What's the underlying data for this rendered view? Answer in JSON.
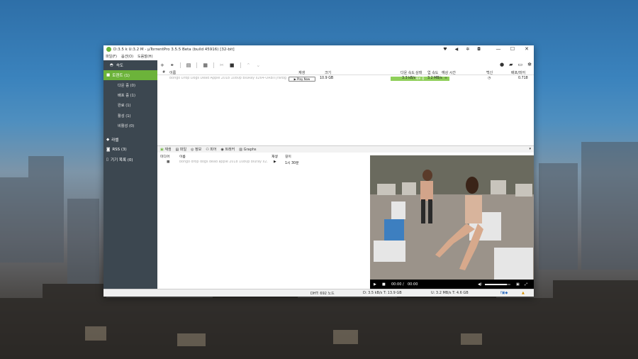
{
  "titlebar": {
    "title": "D:3.5 k U:3.2 M - µTorrentPro 3.5.5 Beta (build 45916) [32-bit]"
  },
  "menu": [
    "파일(F)",
    "옵션(O)",
    "도움말(H)"
  ],
  "sidebar": {
    "speed": "속도",
    "torrents": "토렌트 (1)",
    "subs": [
      "다운 중 (0)",
      "배포 중 (1)",
      "완료 (1)",
      "활성 (1)",
      "비활성 (0)"
    ],
    "labels": "라벨",
    "rss": "RSS (3)",
    "devices": "기기 목록 (0)"
  },
  "columns": {
    "num": "#",
    "name": "이름",
    "play": "재생",
    "size": "크기",
    "status": "상태",
    "down": "다운 속도",
    "up": "업 속도",
    "eta": "예상 시간",
    "seeds": "백신",
    "ratio": "배포/피어"
  },
  "torrent": {
    "name": "Bongo Drop Dogs Dead Apple 2018 1080p BluRay x264-ORBiT[rarbg]",
    "play": "▶ Play Now",
    "size": "10.9 GB",
    "status": "배포 중",
    "down": "3.3 kB/s",
    "up": "3.2 MB/s",
    "eta": "∞",
    "ratio": "0.718"
  },
  "tabs": [
    "재생",
    "파일",
    "정보",
    "피어",
    "트래커",
    "Graphs"
  ],
  "lower": {
    "col_media": "미디어",
    "col_name": "이름",
    "col_play": "재생",
    "col_len": "길이",
    "file_name": "bongo drop dogs dead apple 2018 1080p bluray x2...",
    "duration": "1시 30분"
  },
  "video": {
    "t_cur": "00:00",
    "sep": "/",
    "t_total": "00:00",
    "volume": 0.85
  },
  "statusbar": {
    "dht": "DHT: 692 노드",
    "down": "D: 3.5 kB/s T: 13.9 GB",
    "up": "U: 3.2 MB/s T: 4.6 GB"
  }
}
